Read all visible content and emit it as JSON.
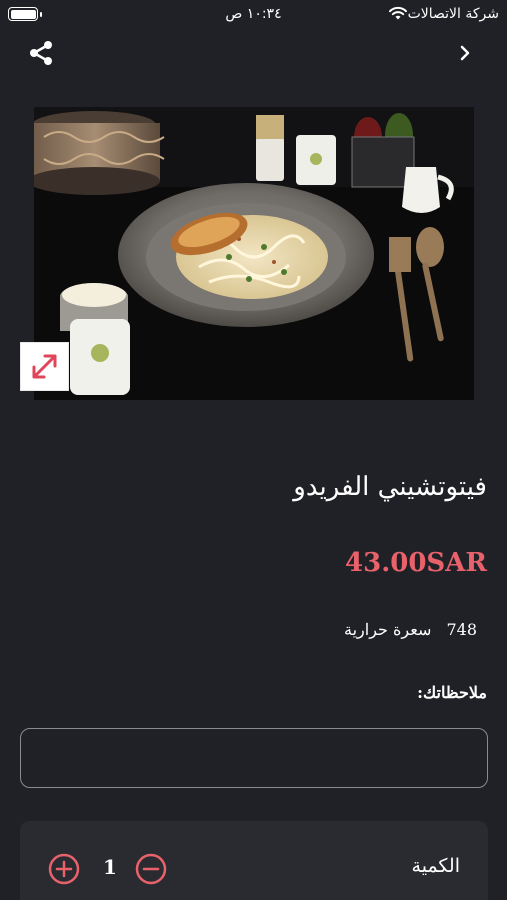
{
  "status_bar": {
    "time": "١٠:٣٤ ص",
    "carrier": "شركة الاتصالات"
  },
  "nav": {
    "share_icon": "share-icon",
    "back_icon": "chevron-right-icon"
  },
  "product": {
    "image_alt": "pasta dish photo",
    "expand_icon": "expand-icon",
    "title": "فيتوتشيني الفريدو",
    "price": "43.00SAR",
    "calories_value": "748",
    "calories_label": "سعرة حرارية"
  },
  "notes": {
    "label": "ملاحظاتك:",
    "value": "",
    "placeholder": ""
  },
  "quantity": {
    "label": "الكمية",
    "value": "1",
    "plus_icon": "plus-circle-icon",
    "minus_icon": "minus-circle-icon"
  },
  "colors": {
    "background": "#202126",
    "accent": "#e8626b",
    "card": "#2a2b31"
  }
}
